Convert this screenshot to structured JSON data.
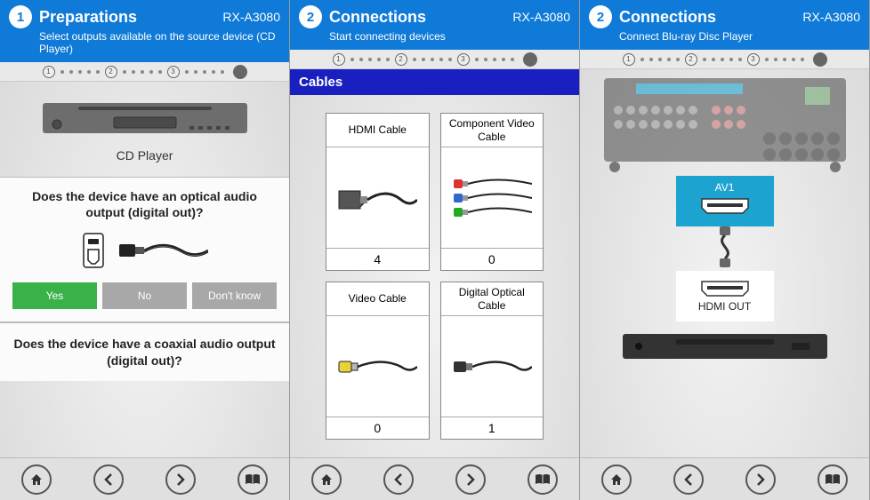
{
  "panels": [
    {
      "step_num": "1",
      "title": "Preparations",
      "model": "RX-A3080",
      "subtitle": "Select outputs available on the source device (CD Player)",
      "stepper_labels": [
        "1",
        "2",
        "3"
      ],
      "device_label": "CD Player",
      "q1": "Does the device have an optical audio output (digital out)?",
      "buttons": {
        "yes": "Yes",
        "no": "No",
        "dont_know": "Don't know"
      },
      "q2": "Does the device have a coaxial audio output (digital out)?"
    },
    {
      "step_num": "2",
      "title": "Connections",
      "model": "RX-A3080",
      "subtitle": "Start connecting devices",
      "stepper_labels": [
        "1",
        "2",
        "3"
      ],
      "section": "Cables",
      "cables": [
        {
          "name": "HDMI Cable",
          "count": "4"
        },
        {
          "name": "Component Video Cable",
          "count": "0"
        },
        {
          "name": "Video Cable",
          "count": "0"
        },
        {
          "name": "Digital Optical Cable",
          "count": "1"
        }
      ]
    },
    {
      "step_num": "2",
      "title": "Connections",
      "model": "RX-A3080",
      "subtitle": "Connect Blu-ray Disc Player",
      "stepper_labels": [
        "1",
        "2",
        "3"
      ],
      "port1": "AV1",
      "port2": "HDMI OUT"
    }
  ],
  "nav": {
    "home": "home",
    "prev": "prev",
    "next": "next",
    "guide": "guide"
  }
}
